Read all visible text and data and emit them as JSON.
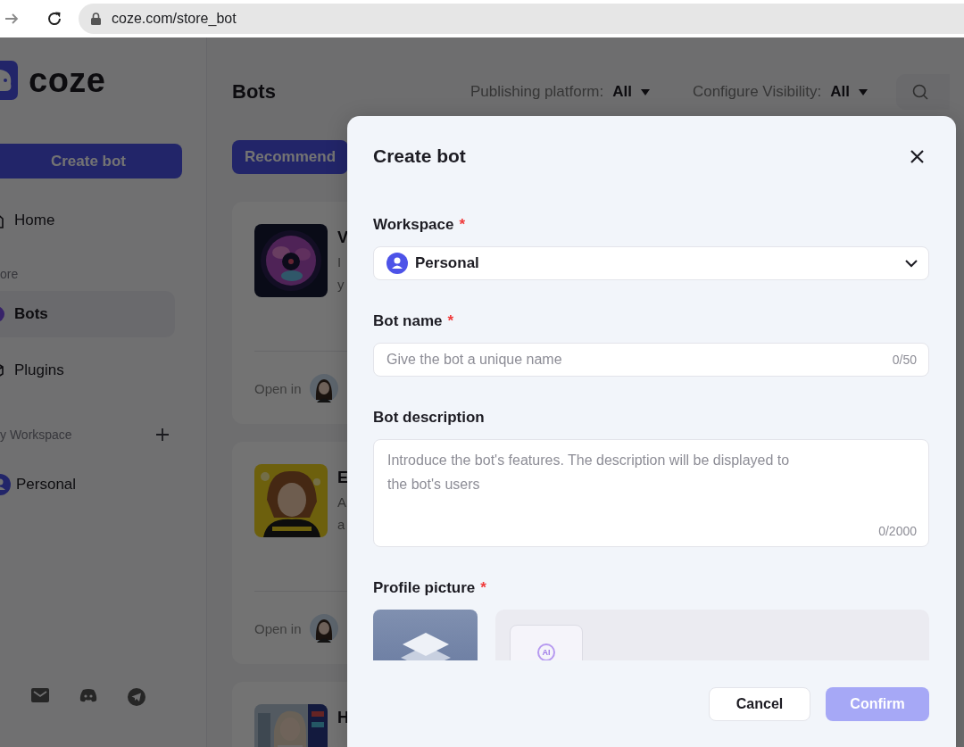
{
  "browser": {
    "url": "coze.com/store_bot"
  },
  "sidebar": {
    "logo": "coze",
    "create_button": "Create bot",
    "nav": [
      {
        "kind": "home",
        "label": "Home",
        "selected": false
      },
      {
        "kind": "store-heading",
        "label": "ore"
      },
      {
        "kind": "bots",
        "label": "Bots",
        "selected": true
      },
      {
        "kind": "plugins",
        "label": "Plugins",
        "selected": false
      },
      {
        "kind": "workspace-heading",
        "label": "y Workspace"
      },
      {
        "kind": "workspace",
        "label": "Personal"
      }
    ]
  },
  "main": {
    "title": "Bots",
    "filters": [
      {
        "label": "Publishing platform:",
        "value": "All"
      },
      {
        "label": "Configure Visibility:",
        "value": "All"
      }
    ],
    "tabs": [
      {
        "label": "Recommend",
        "selected": true
      }
    ],
    "cards": [
      {
        "title": "V",
        "description": [
          "I",
          "y"
        ],
        "open_in": "Open in"
      },
      {
        "title": "E",
        "description": [
          "A",
          "a"
        ],
        "open_in": "Open in"
      },
      {
        "title": "H"
      }
    ]
  },
  "dialog": {
    "title": "Create bot",
    "required_mark": "*",
    "fields": [
      {
        "kind": "select",
        "label": "Workspace",
        "required": true,
        "value": "Personal"
      },
      {
        "kind": "input",
        "label": "Bot name",
        "required": true,
        "placeholder": "Give the bot a unique name",
        "count": "0/50"
      },
      {
        "kind": "textarea",
        "label": "Bot description",
        "required": false,
        "placeholder": "Introduce the bot's features. The description will be displayed to the bot's users",
        "count": "0/2000"
      },
      {
        "kind": "avatar",
        "label": "Profile picture",
        "required": true,
        "badge": "AI"
      }
    ],
    "buttons": [
      {
        "label": "Cancel",
        "kind": "secondary",
        "disabled": false
      },
      {
        "label": "Confirm",
        "kind": "primary",
        "disabled": true
      }
    ]
  }
}
